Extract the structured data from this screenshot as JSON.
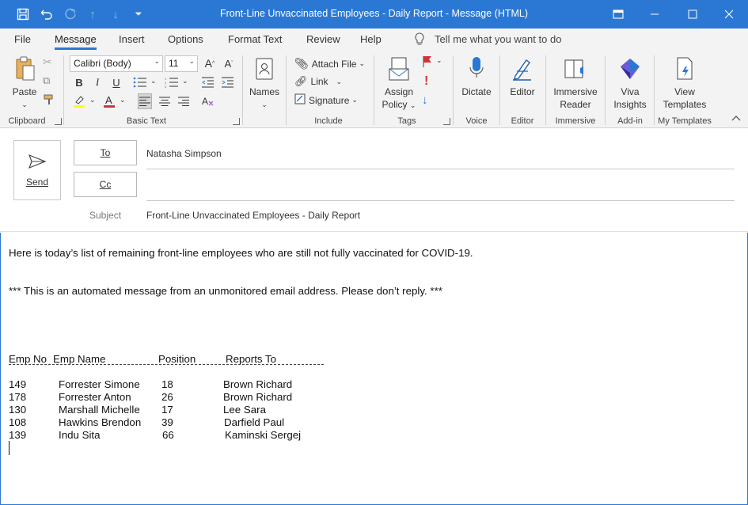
{
  "window": {
    "title": "Front-Line Unvaccinated Employees - Daily Report  -  Message (HTML)"
  },
  "tabs": [
    "File",
    "Message",
    "Insert",
    "Options",
    "Format Text",
    "Review",
    "Help"
  ],
  "active_tab": "Message",
  "tell_me": "Tell me what you want to do",
  "ribbon": {
    "clipboard": {
      "paste": "Paste",
      "label": "Clipboard"
    },
    "basic_text": {
      "font": "Calibri (Body)",
      "size": "11",
      "label": "Basic Text"
    },
    "names": {
      "label": "Names"
    },
    "include": {
      "attach_file": "Attach File",
      "link": "Link",
      "signature": "Signature",
      "label": "Include"
    },
    "tags": {
      "assign_policy_1": "Assign",
      "assign_policy_2": "Policy",
      "label": "Tags"
    },
    "voice": {
      "dictate": "Dictate",
      "label": "Voice"
    },
    "editor": {
      "editor": "Editor",
      "label": "Editor"
    },
    "immersive": {
      "btn_1": "Immersive",
      "btn_2": "Reader",
      "label": "Immersive"
    },
    "addin": {
      "btn_1": "Viva",
      "btn_2": "Insights",
      "label": "Add-in"
    },
    "templates": {
      "btn_1": "View",
      "btn_2": "Templates",
      "label": "My Templates"
    }
  },
  "compose": {
    "send": "Send",
    "to_label": "To",
    "cc_label": "Cc",
    "subject_label": "Subject",
    "to_value": "Natasha Simpson",
    "cc_value": "",
    "subject_value": "Front-Line Unvaccinated Employees - Daily Report"
  },
  "body": {
    "intro": "Here is today’s list of remaining front-line employees who are still not fully vaccinated for COVID-19.",
    "notice": "*** This is an automated message from an unmonitored email address. Please don’t reply. ***",
    "table": {
      "headers": [
        "Emp No",
        "Emp Name",
        "Position",
        "Reports To"
      ],
      "rows": [
        [
          "149",
          "Forrester Simone",
          "18",
          "Brown Richard"
        ],
        [
          "178",
          "Forrester Anton",
          "26",
          "Brown Richard"
        ],
        [
          "130",
          "Marshall Michelle",
          "17",
          "Lee Sara"
        ],
        [
          "108",
          "Hawkins Brendon",
          "39",
          "Darfield Paul"
        ],
        [
          "139",
          "Indu Sita",
          "66",
          "Kaminski Sergej"
        ]
      ]
    }
  },
  "colors": {
    "accent": "#2b78d4",
    "ribbon_bg": "#f3f3f3"
  }
}
